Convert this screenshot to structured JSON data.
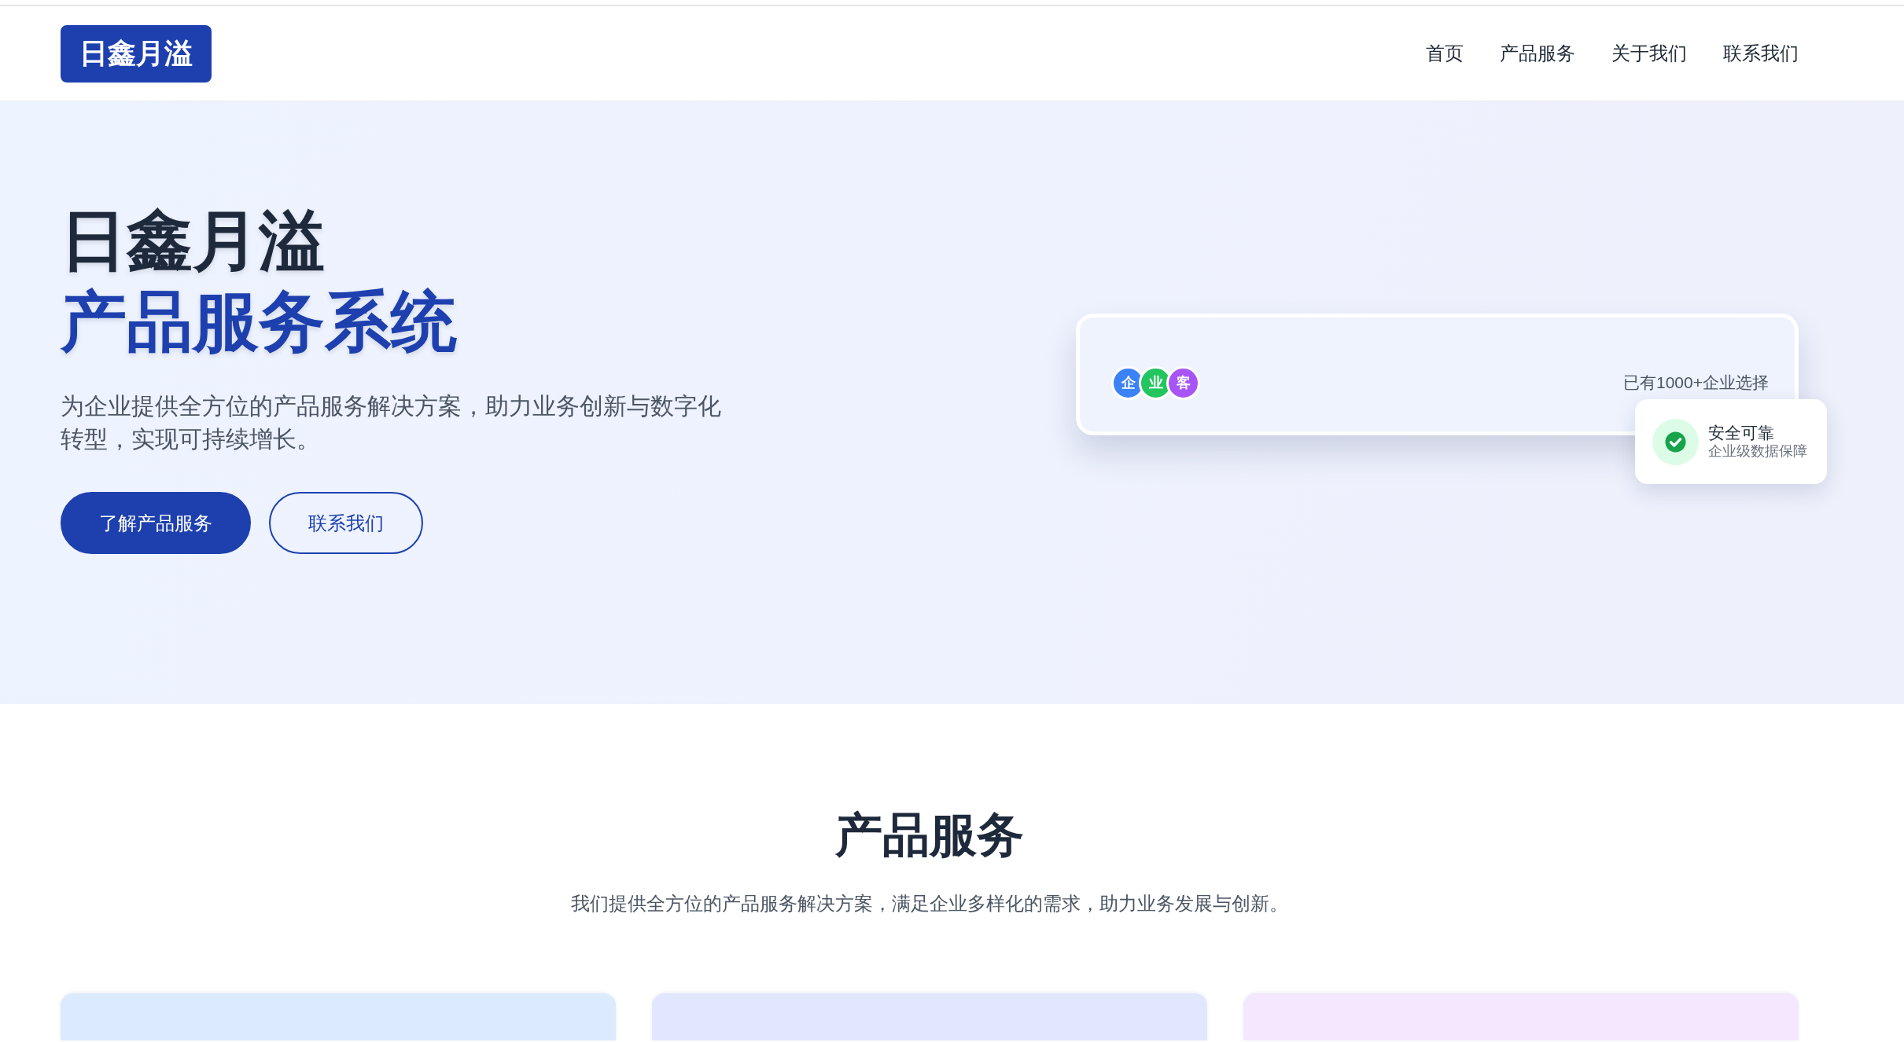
{
  "navbar": {
    "logo": "日鑫月溢",
    "links": [
      {
        "label": "首页"
      },
      {
        "label": "产品服务"
      },
      {
        "label": "关于我们"
      },
      {
        "label": "联系我们"
      }
    ]
  },
  "hero": {
    "title": "日鑫月溢",
    "highlight": "产品服务系统",
    "description": "为企业提供全方位的产品服务解决方案，助力业务创新与数字化转型，实现可持续增长。",
    "buttons": [
      {
        "label": "了解产品服务",
        "kind": "primary"
      },
      {
        "label": "联系我们",
        "kind": "outline"
      }
    ],
    "stats_card": {
      "avatars": [
        {
          "label": "企",
          "color": "#3b82f6"
        },
        {
          "label": "业",
          "color": "#22c55e"
        },
        {
          "label": "客",
          "color": "#a855f7"
        }
      ],
      "text": "已有1000+企业选择"
    },
    "security_card": {
      "title": "安全可靠",
      "subtitle": "企业级数据保障"
    }
  },
  "products": {
    "title": "产品服务",
    "subtitle": "我们提供全方位的产品服务解决方案，满足企业多样化的需求，助力业务发展与创新。",
    "cards": [
      {
        "color": "#dbeafe"
      },
      {
        "color": "#e0e7ff"
      },
      {
        "color": "#f3e8ff"
      }
    ]
  }
}
